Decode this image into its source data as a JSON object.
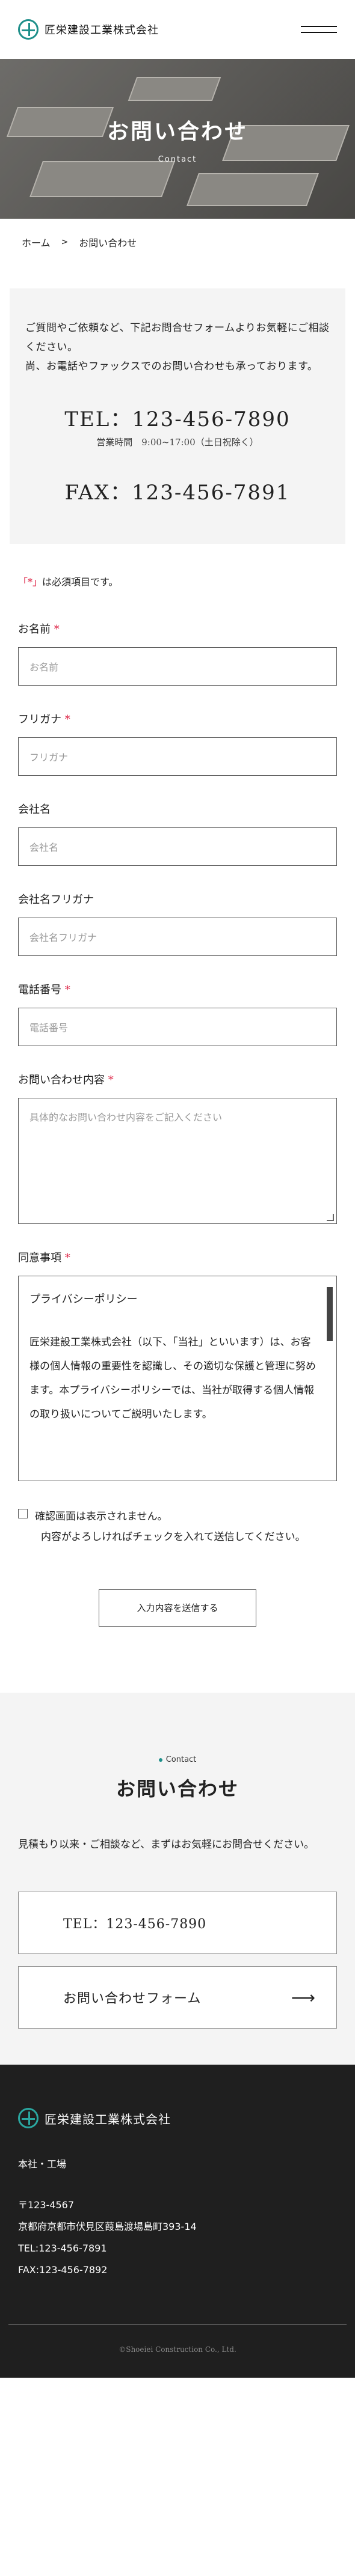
{
  "header": {
    "logo_text": "匠栄建設工業株式会社"
  },
  "hero": {
    "title": "お問い合わせ",
    "subtitle": "Contact"
  },
  "breadcrumb": {
    "home": "ホーム",
    "separator": ">",
    "current": "お問い合わせ"
  },
  "info": {
    "line1": "ご質問やご依頼など、下記お問合せフォームよりお気軽にご相談ください。",
    "line2": "尚、お電話やファックスでのお問い合わせも承っております。",
    "tel": "TEL：123-456-7890",
    "hours": "営業時間　9:00~17:00（土日祝除く）",
    "fax": "FAX：123-456-7891"
  },
  "form": {
    "req_mark": "「*」",
    "req_note": "は必須項目です。",
    "fields": [
      {
        "label": "お名前",
        "required": "*",
        "placeholder": "お名前"
      },
      {
        "label": "フリガナ",
        "required": "*",
        "placeholder": "フリガナ"
      },
      {
        "label": "会社名",
        "required": "",
        "placeholder": "会社名"
      },
      {
        "label": "会社名フリガナ",
        "required": "",
        "placeholder": "会社名フリガナ"
      },
      {
        "label": "電話番号",
        "required": "*",
        "placeholder": "電話番号"
      },
      {
        "label": "お問い合わせ内容",
        "required": "*",
        "placeholder": "具体的なお問い合わせ内容をご記入ください"
      }
    ],
    "agree_label": "同意事項",
    "agree_required": "*",
    "agree_title": "プライバシーポリシー",
    "agree_body": "匠栄建設工業株式会社（以下、「当社」といいます）は、お客様の個人情報の重要性を認識し、その適切な保護と管理に努めます。本プライバシーポリシーでは、当社が取得する個人情報の取り扱いについてご説明いたします。",
    "check_text": "確認画面は表示されません。",
    "check_sub": "内容がよろしければチェックを入れて送信してください。",
    "submit": "入力内容を送信する"
  },
  "contact": {
    "kicker": "Contact",
    "title": "お問い合わせ",
    "desc": "見積もり以来・ご相談など、まずはお気軽にお問合せください。",
    "tel_button": "TEL：123-456-7890",
    "form_button": "お問い合わせフォーム",
    "arrow": "⟶"
  },
  "footer": {
    "logo_text": "匠栄建設工業株式会社",
    "office": "本社・工場",
    "zip": "〒123-4567",
    "address": "京都府京都市伏見区葭島渡場島町393-14",
    "tel": "TEL:123-456-7891",
    "fax": "FAX:123-456-7892",
    "copyright": "©Shoeiei Construction Co., Ltd."
  },
  "colors": {
    "accent": "#1e8f8a",
    "required": "#dd2244",
    "footer_bg": "#1f1f1f",
    "panel_bg": "#f4f4f4"
  },
  "icons": {
    "logo": "logo-mark-icon",
    "menu": "hamburger-menu-icon",
    "arrow": "arrow-right-icon",
    "check": "checkbox-icon"
  }
}
